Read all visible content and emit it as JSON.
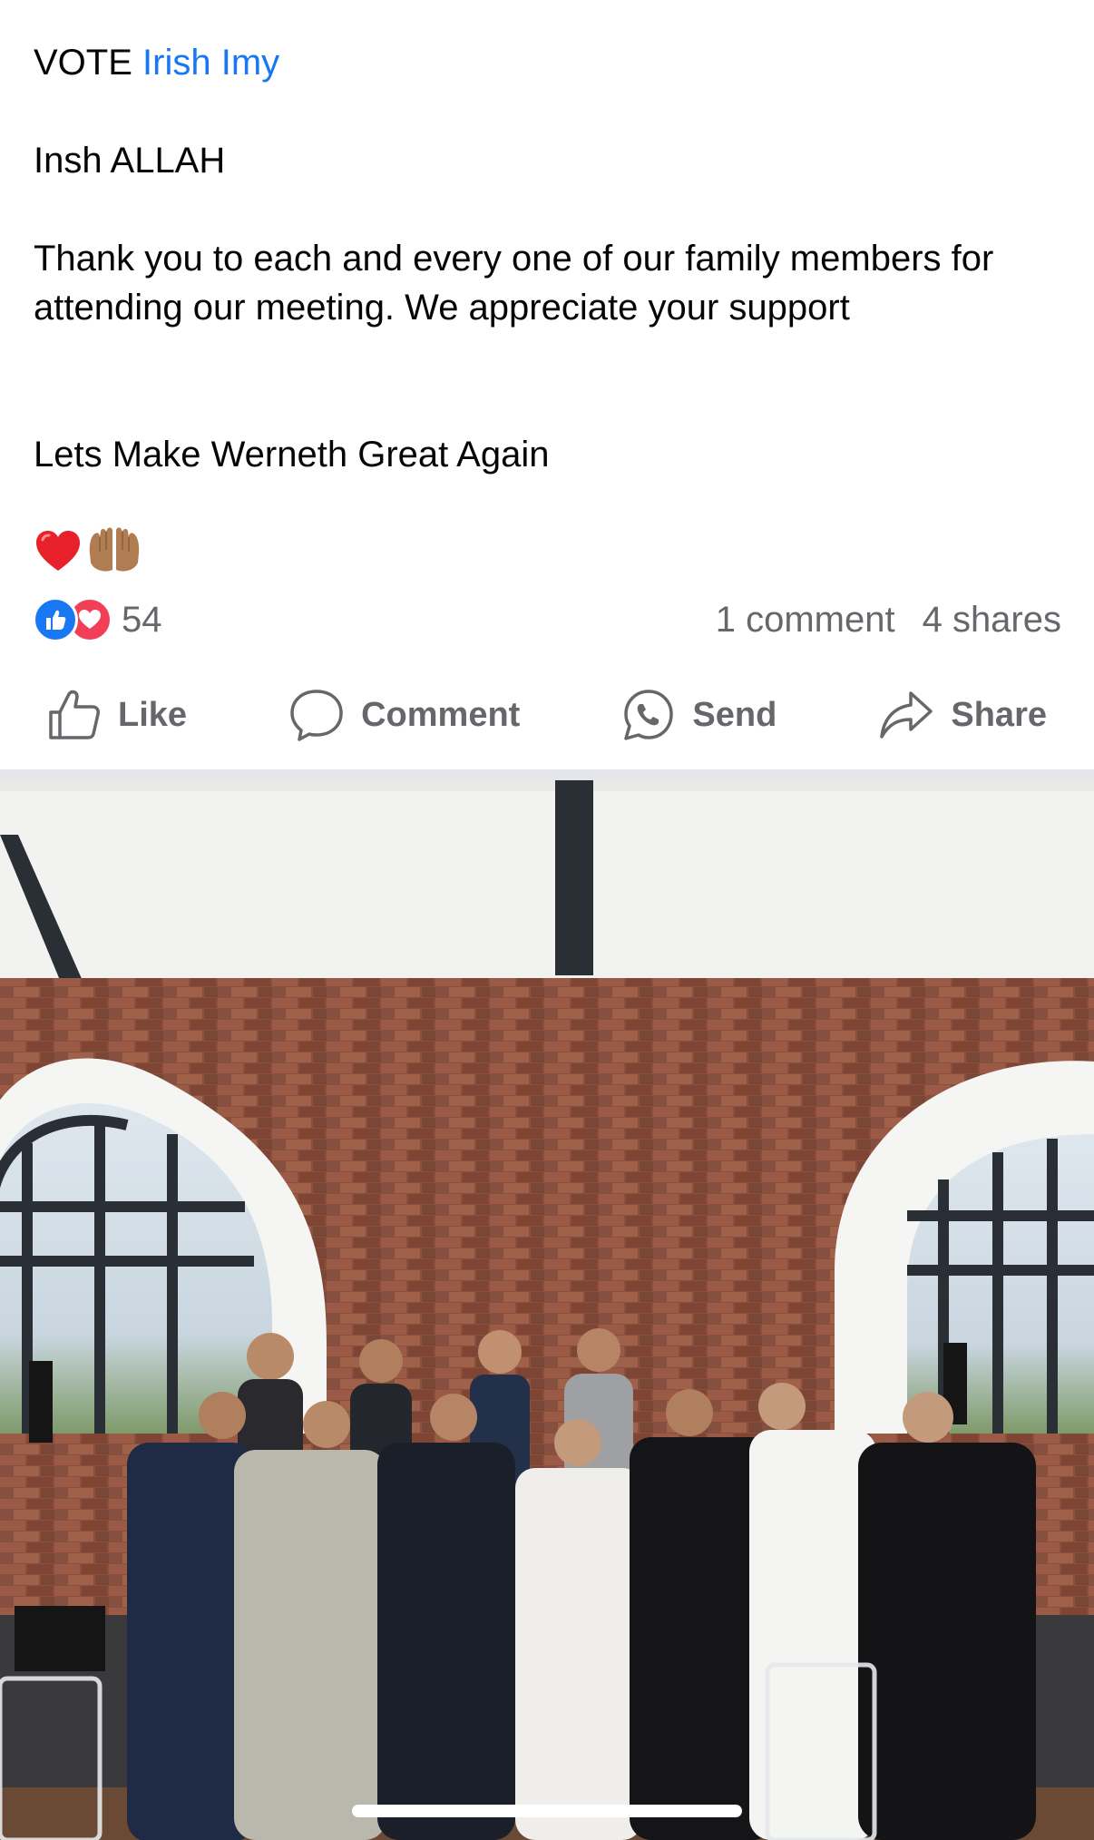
{
  "post": {
    "vote_prefix": "VOTE ",
    "mention": "Irish Imy",
    "line_insh": "Insh ALLAH",
    "line_thanks": "Thank you to each and every one of our family members for attending our meeting. We appreciate your support",
    "line_lets": "Lets Make Werneth Great Again",
    "emojis": [
      "red-heart-emoji",
      "palms-up-together-emoji"
    ]
  },
  "reactions": {
    "icons": [
      "like-reaction-icon",
      "love-reaction-icon"
    ],
    "count": "54",
    "comments": "1 comment",
    "shares": "4 shares"
  },
  "actions": {
    "like": "Like",
    "comment": "Comment",
    "send": "Send",
    "share": "Share"
  },
  "colors": {
    "mention": "#1877f2",
    "secondary_text": "#65676b",
    "like_blue": "#1877f2",
    "love_red": "#f33e58"
  }
}
